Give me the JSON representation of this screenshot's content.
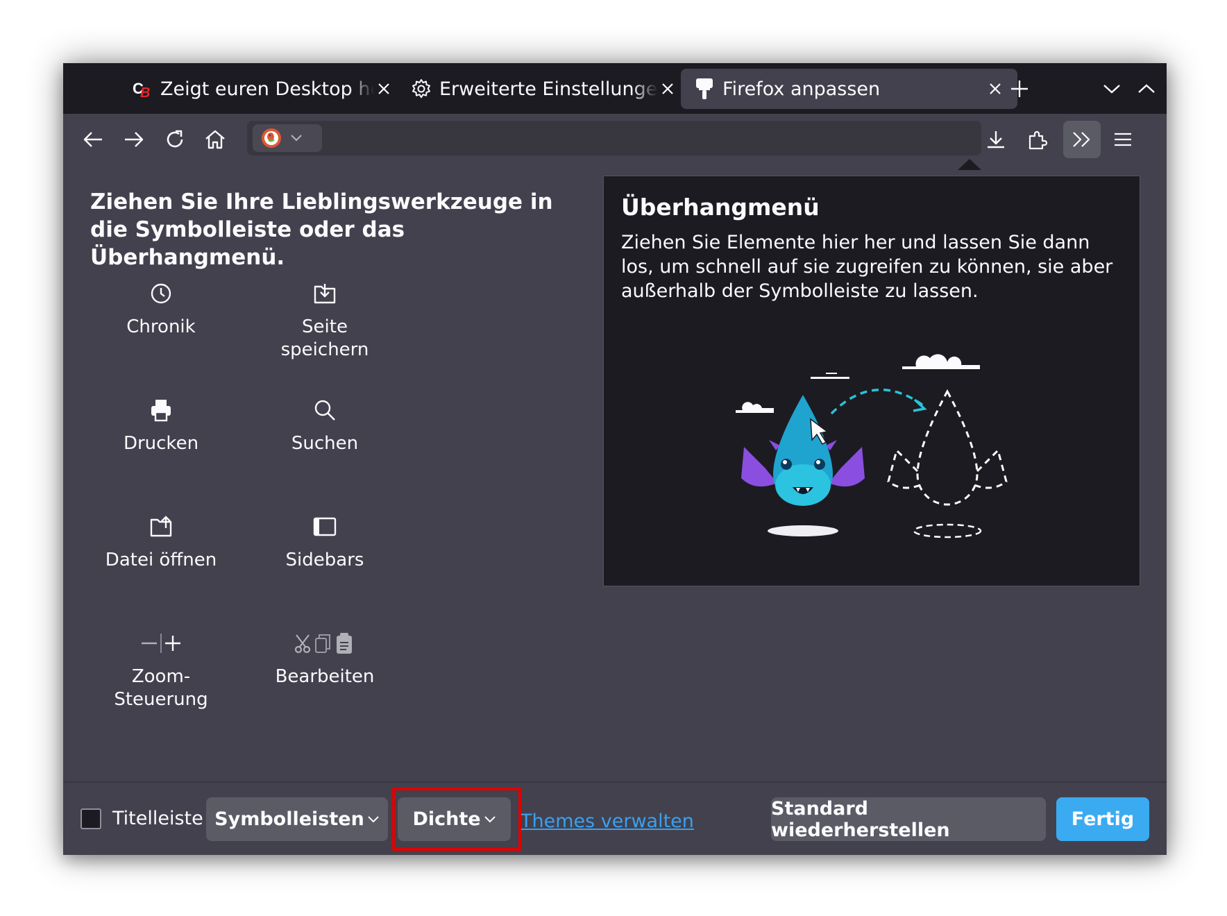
{
  "tabs": [
    {
      "title": "Zeigt euren Desktop her",
      "favicon": "computerbase-icon",
      "active": false
    },
    {
      "title": "Erweiterte Einstellungen",
      "favicon": "gear-icon",
      "active": false
    },
    {
      "title": "Firefox anpassen",
      "favicon": "paintbrush-icon",
      "active": true
    }
  ],
  "tabstrip": {
    "new_tab_icon": "plus-icon",
    "list_all_tabs_icon": "chevron-down-icon",
    "window_controls": [
      "chevron-down-icon",
      "chevron-up-icon",
      "close-icon"
    ]
  },
  "navbar": {
    "buttons": [
      "back-arrow-icon",
      "forward-arrow-icon",
      "reload-icon",
      "home-icon"
    ],
    "search_engine_icon": "duckduckgo-icon",
    "right_buttons": [
      "download-icon",
      "extensions-icon",
      "overflow-chevrons-icon",
      "hamburger-menu-icon"
    ]
  },
  "customize": {
    "heading": "Ziehen Sie Ihre Lieblingswerkzeuge in die Symbolleiste oder das Überhangmenü.",
    "palette": [
      {
        "label": "Chronik",
        "icon": "clock-icon"
      },
      {
        "label": "Seite speichern",
        "icon": "save-page-icon"
      },
      {
        "label": "Drucken",
        "icon": "printer-icon"
      },
      {
        "label": "Suchen",
        "icon": "search-icon"
      },
      {
        "label": "Datei öffnen",
        "icon": "open-file-icon"
      },
      {
        "label": "Sidebars",
        "icon": "sidebar-icon"
      },
      {
        "label": "Zoom-Steuerung",
        "icon": "zoom-controls-icon"
      },
      {
        "label": "Bearbeiten",
        "icon": "edit-controls-icon"
      }
    ]
  },
  "overflow_panel": {
    "title": "Überhangmenü",
    "description": "Ziehen Sie Elemente hier her und lassen Sie dann los, um schnell auf sie zugreifen zu können, sie aber außerhalb der Symbolleiste zu lassen.",
    "illustration": "dragon-mascot-illustration"
  },
  "footer": {
    "titlebar_checkbox_label": "Titelleiste",
    "titlebar_checked": false,
    "toolbars_button": "Symbolleisten",
    "density_button": "Dichte",
    "themes_link": "Themes verwalten",
    "restore_defaults_button": "Standard wiederherstellen",
    "done_button": "Fertig"
  },
  "colors": {
    "window_bg": "#42414d",
    "tabstrip_bg": "#1c1b22",
    "text": "#fbfbfe",
    "accent_button": "#3aabf0",
    "link": "#3aa0f0",
    "highlight": "#e00000"
  }
}
